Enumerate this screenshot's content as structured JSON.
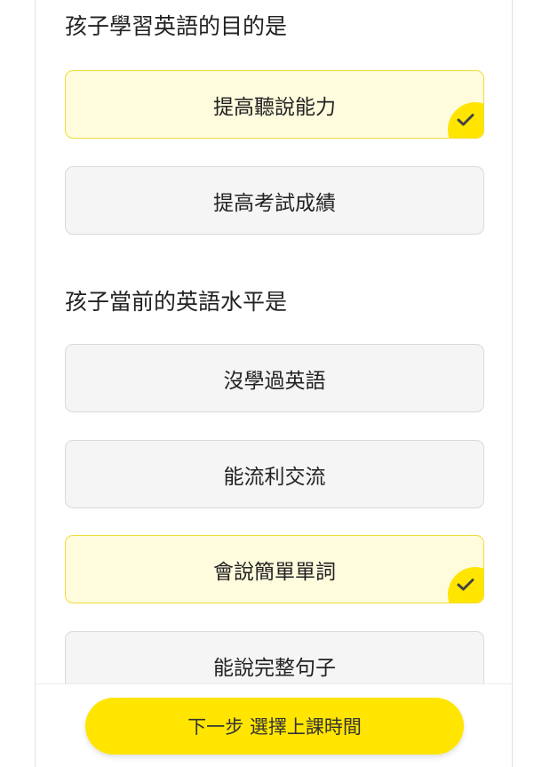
{
  "questions": [
    {
      "title": "孩子學習英語的目的是",
      "options": [
        {
          "label": "提高聽說能力",
          "selected": true
        },
        {
          "label": "提高考試成績",
          "selected": false
        }
      ]
    },
    {
      "title": "孩子當前的英語水平是",
      "options": [
        {
          "label": "沒學過英語",
          "selected": false
        },
        {
          "label": "能流利交流",
          "selected": false
        },
        {
          "label": "會說簡單單詞",
          "selected": true
        },
        {
          "label": "能說完整句子",
          "selected": false
        }
      ]
    }
  ],
  "footer": {
    "next_label": "下一步 選擇上課時間"
  },
  "icons": {
    "selected_marker": "check-icon"
  },
  "colors": {
    "accent": "#ffe500",
    "selected_bg": "#fffbdd",
    "selected_border": "#f2dc3a",
    "option_bg": "#f5f5f5"
  }
}
